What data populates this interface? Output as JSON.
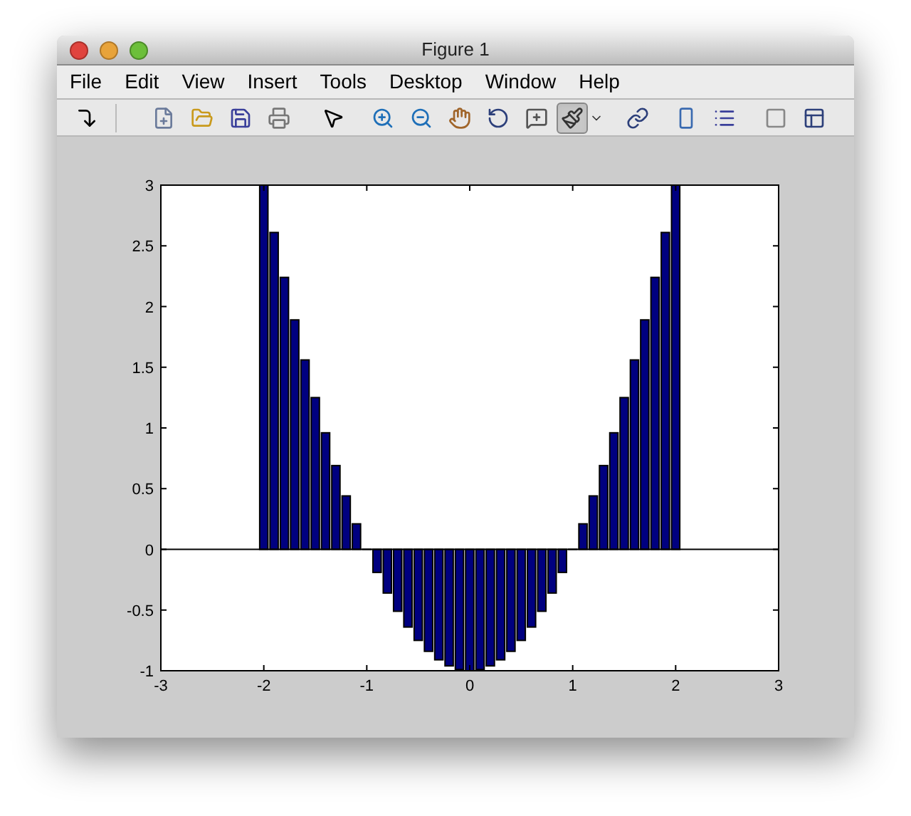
{
  "window": {
    "title": "Figure 1"
  },
  "menu": [
    "File",
    "Edit",
    "View",
    "Insert",
    "Tools",
    "Desktop",
    "Window",
    "Help"
  ],
  "toolbar_buttons": [
    {
      "pressed": false
    },
    {
      "pressed": false
    },
    {
      "pressed": false
    },
    {
      "pressed": false
    },
    {
      "pressed": false
    },
    {
      "pressed": false
    },
    {
      "pressed": false
    },
    {
      "pressed": false
    },
    {
      "pressed": false
    },
    {
      "pressed": false
    },
    {
      "pressed": false
    },
    {
      "pressed": true
    },
    {
      "pressed": false
    },
    {
      "pressed": false
    },
    {
      "pressed": false
    },
    {
      "pressed": false
    },
    {
      "pressed": false
    },
    {
      "pressed": false
    }
  ],
  "figure": {
    "chart_data": {
      "type": "bar",
      "x": [
        -2,
        -1.9,
        -1.8,
        -1.7,
        -1.6,
        -1.5,
        -1.4,
        -1.3,
        -1.2,
        -1.1,
        -1,
        -0.9,
        -0.8,
        -0.7,
        -0.6,
        -0.5,
        -0.4,
        -0.3,
        -0.2,
        -0.1,
        0,
        0.1,
        0.2,
        0.3,
        0.4,
        0.5,
        0.6,
        0.7,
        0.8,
        0.9,
        1,
        1.1,
        1.2,
        1.3,
        1.4,
        1.5,
        1.6,
        1.7,
        1.8,
        1.9,
        2
      ],
      "series": [
        {
          "color": "#000080",
          "values": [
            3,
            2.61,
            2.24,
            1.89,
            1.56,
            1.25,
            0.96,
            0.69,
            0.44,
            0.21,
            0,
            -0.19,
            -0.36,
            -0.51,
            -0.64,
            -0.75,
            -0.84,
            -0.91,
            -0.96,
            -0.99,
            -1,
            -0.99,
            -0.96,
            -0.91,
            -0.84,
            -0.75,
            -0.64,
            -0.51,
            -0.36,
            -0.19,
            0,
            0.21,
            0.44,
            0.69,
            0.96,
            1.25,
            1.56,
            1.89,
            2.24,
            2.61,
            3
          ]
        }
      ],
      "xlim": [
        -3,
        3
      ],
      "ylim": [
        -1,
        3
      ],
      "xticks": [
        -3,
        -2,
        -1,
        0,
        1,
        2,
        3
      ],
      "yticks": [
        -1,
        {
          "value": -0.5,
          "label": "-0.5"
        },
        0,
        {
          "value": 0.5,
          "label": "0.5"
        },
        1,
        {
          "value": 1.5,
          "label": "1.5"
        },
        2,
        {
          "value": 2.5,
          "label": "2.5"
        },
        3
      ]
    }
  }
}
